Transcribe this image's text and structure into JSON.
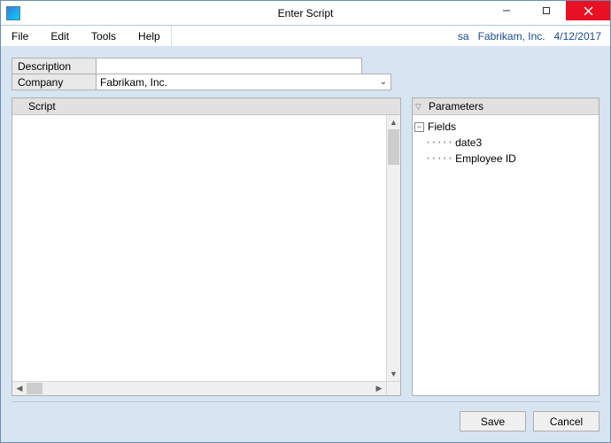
{
  "window": {
    "title": "Enter Script"
  },
  "menubar": {
    "items": [
      "File",
      "Edit",
      "Tools",
      "Help"
    ],
    "status": {
      "user": "sa",
      "company": "Fabrikam, Inc.",
      "date": "4/12/2017"
    }
  },
  "form": {
    "description_label": "Description",
    "description_value": "",
    "company_label": "Company",
    "company_selected": "Fabrikam, Inc."
  },
  "script_panel": {
    "title": "Script",
    "content": ""
  },
  "parameters_panel": {
    "title": "Parameters",
    "tree": {
      "root_label": "Fields",
      "children": [
        "date3",
        "Employee ID"
      ]
    }
  },
  "footer": {
    "save_label": "Save",
    "cancel_label": "Cancel"
  }
}
